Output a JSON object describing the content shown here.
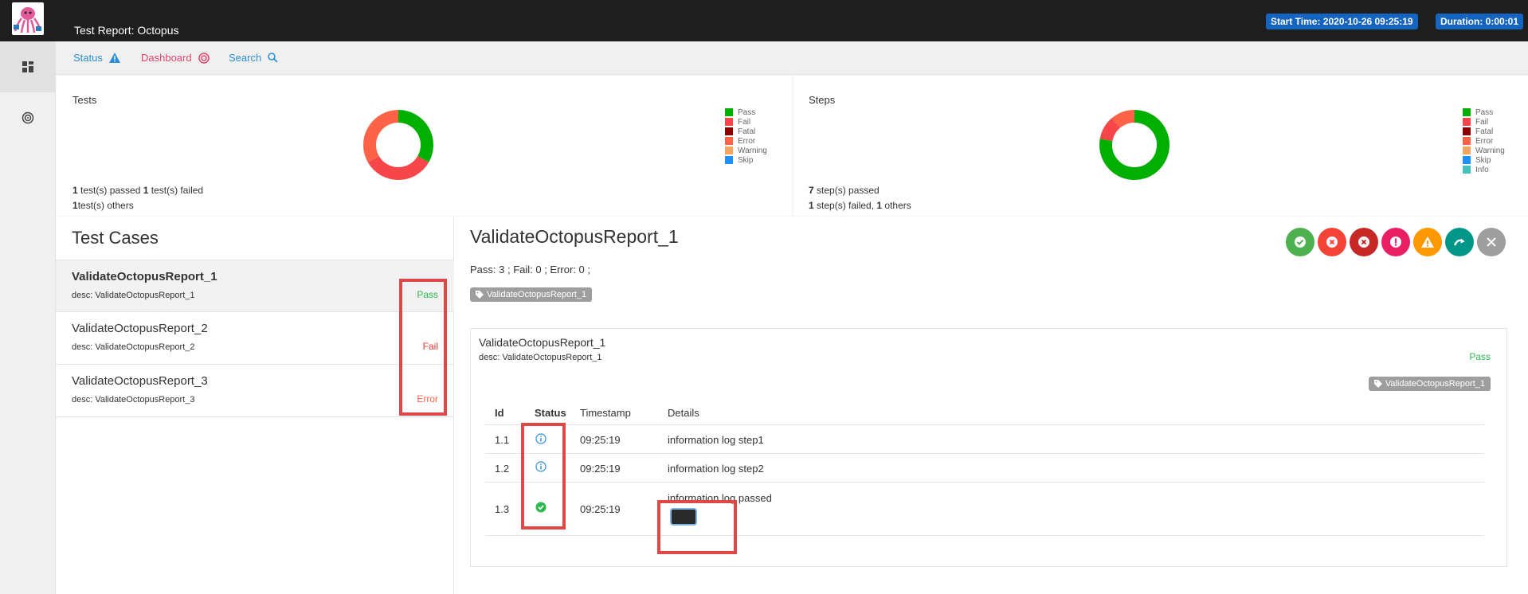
{
  "topbar": {
    "title": "Test Report: Octopus",
    "start_time": "Start Time: 2020-10-26 09:25:19",
    "duration": "Duration: 0:00:01"
  },
  "nav": {
    "status": "Status",
    "dashboard": "Dashboard",
    "search": "Search"
  },
  "tests_panel": {
    "title": "Tests",
    "line1_a": "1",
    "line1_b": " test(s) passed ",
    "line1_c": "1",
    "line1_d": " test(s) failed",
    "line2_a": "1",
    "line2_b": "test(s) others",
    "legend": [
      "Pass",
      "Fail",
      "Fatal",
      "Error",
      "Warning",
      "Skip"
    ],
    "donut": [
      {
        "label": "Pass",
        "value": 1,
        "color": "#00af00"
      },
      {
        "label": "Fail",
        "value": 1,
        "color": "#f7464a"
      },
      {
        "label": "Error",
        "value": 1,
        "color": "#ff6347"
      }
    ]
  },
  "steps_panel": {
    "title": "Steps",
    "line1_a": "7",
    "line1_b": " step(s) passed",
    "line2_a": "1",
    "line2_b": " step(s) failed, ",
    "line2_c": "1",
    "line2_d": " others",
    "legend": [
      "Pass",
      "Fail",
      "Fatal",
      "Error",
      "Warning",
      "Skip",
      "Info"
    ],
    "donut": [
      {
        "label": "Pass",
        "value": 7,
        "color": "#00af00"
      },
      {
        "label": "Fail",
        "value": 1,
        "color": "#f7464a"
      },
      {
        "label": "Error",
        "value": 1,
        "color": "#ff6347"
      }
    ]
  },
  "legend_colors": {
    "Pass": "#00af00",
    "Fail": "#f7464a",
    "Fatal": "#8b0000",
    "Error": "#ff6347",
    "Warning": "#f3a662",
    "Skip": "#1e90ff",
    "Info": "#46bfbd"
  },
  "test_cases": {
    "heading": "Test Cases",
    "items": [
      {
        "name": "ValidateOctopusReport_1",
        "desc": "desc: ValidateOctopusReport_1",
        "status": "Pass",
        "color": "#2db94d"
      },
      {
        "name": "ValidateOctopusReport_2",
        "desc": "desc: ValidateOctopusReport_2",
        "status": "Fail",
        "color": "#e53935"
      },
      {
        "name": "ValidateOctopusReport_3",
        "desc": "desc: ValidateOctopusReport_3",
        "status": "Error",
        "color": "#ff6347"
      }
    ]
  },
  "detail": {
    "title": "ValidateOctopusReport_1",
    "stats": "Pass: 3 ; Fail: 0 ; Error: 0 ;",
    "tag": "ValidateOctopusReport_1",
    "card": {
      "title": "ValidateOctopusReport_1",
      "desc": "desc: ValidateOctopusReport_1",
      "status": "Pass",
      "tag": "ValidateOctopusReport_1",
      "columns": [
        "Id",
        "Status",
        "Timestamp",
        "Details"
      ],
      "rows": [
        {
          "id": "1.1",
          "status_icon": "info-icon",
          "time": "09:25:19",
          "details": "information log step1"
        },
        {
          "id": "1.2",
          "status_icon": "info-icon",
          "time": "09:25:19",
          "details": "information log step2"
        },
        {
          "id": "1.3",
          "status_icon": "pass-check-icon",
          "time": "09:25:19",
          "details": "information log passed"
        }
      ]
    }
  },
  "filter_buttons": [
    {
      "icon": "pass-filter-icon",
      "color": "#4caf50"
    },
    {
      "icon": "fail-filter-icon",
      "color": "#f44336"
    },
    {
      "icon": "fatal-filter-icon",
      "color": "#c62828"
    },
    {
      "icon": "error-filter-icon",
      "color": "#e91e63"
    },
    {
      "icon": "warning-filter-icon",
      "color": "#ff9800"
    },
    {
      "icon": "skip-filter-icon",
      "color": "#009688"
    },
    {
      "icon": "clear-filter-icon",
      "color": "#9e9e9e"
    }
  ]
}
